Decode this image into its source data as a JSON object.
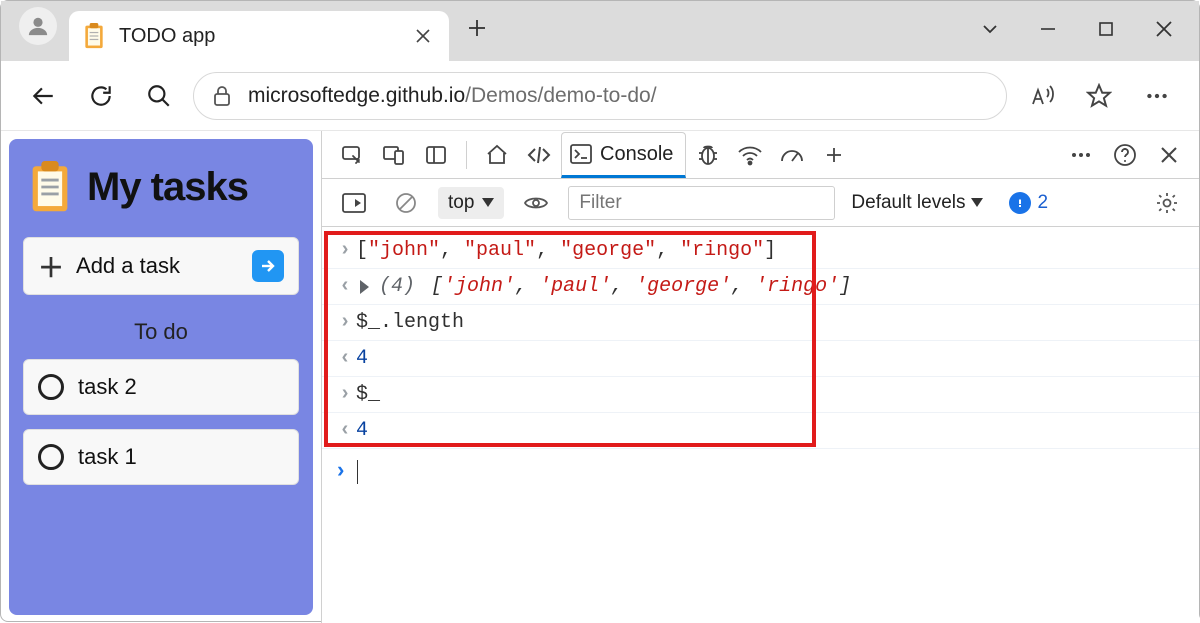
{
  "browser": {
    "tab_title": "TODO app",
    "url_host": "microsoftedge.github.io",
    "url_path": "/Demos/demo-to-do/"
  },
  "page": {
    "title": "My tasks",
    "add_task_placeholder": "Add a task",
    "section_label": "To do",
    "tasks": [
      "task 2",
      "task 1"
    ]
  },
  "devtools": {
    "active_tab": "Console",
    "context": "top",
    "filter_placeholder": "Filter",
    "levels_label": "Default levels",
    "issues_count": "2"
  },
  "console": {
    "lines": [
      {
        "type": "input_array",
        "tokens": [
          "[",
          "\"john\"",
          ", ",
          "\"paul\"",
          ", ",
          "\"george\"",
          ", ",
          "\"ringo\"",
          "]"
        ]
      },
      {
        "type": "output_array",
        "count": "(4)",
        "tokens": [
          "[",
          "'john'",
          ", ",
          "'paul'",
          ", ",
          "'george'",
          ", ",
          "'ringo'",
          "]"
        ]
      },
      {
        "type": "input_plain",
        "text": "$_.length"
      },
      {
        "type": "output_num",
        "text": "4"
      },
      {
        "type": "input_plain",
        "text": "$_"
      },
      {
        "type": "output_num",
        "text": "4"
      }
    ]
  }
}
